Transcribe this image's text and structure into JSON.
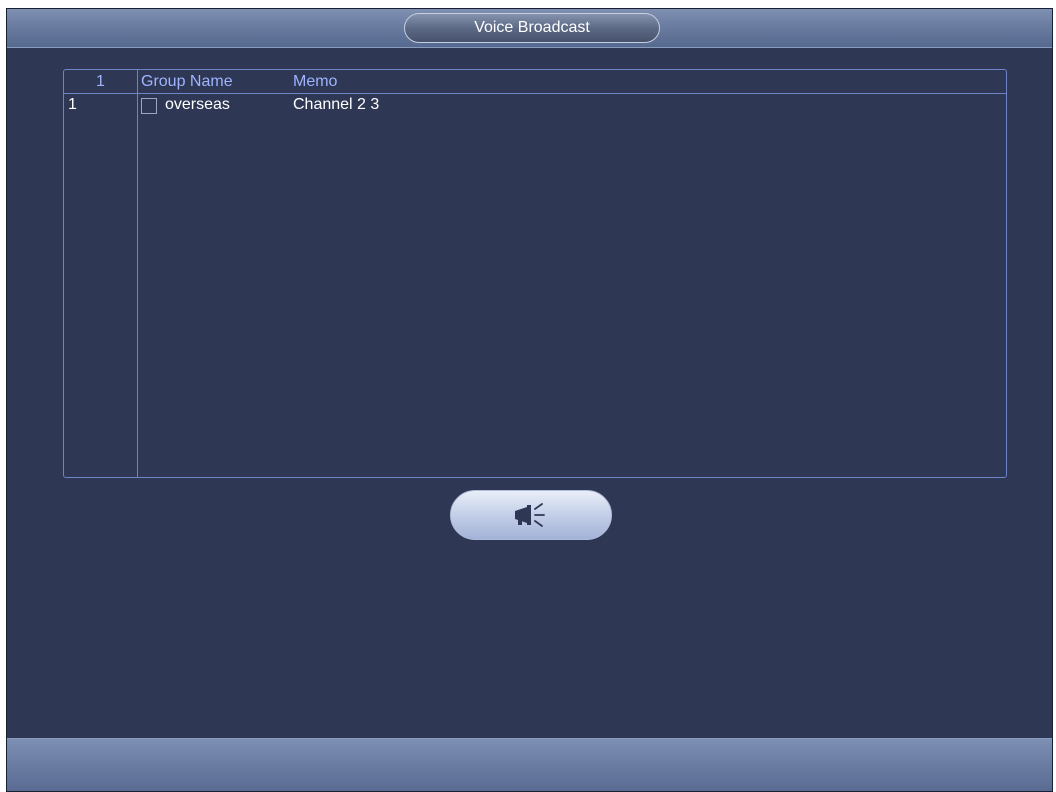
{
  "window": {
    "title": "Voice Broadcast"
  },
  "table": {
    "columns": {
      "index": "1",
      "group_name": "Group Name",
      "memo": "Memo"
    },
    "rows": [
      {
        "index": "1",
        "checked": false,
        "group_name": "overseas",
        "memo": "Channel  2  3"
      }
    ]
  },
  "broadcast_button": {
    "icon": "megaphone-icon"
  },
  "colors": {
    "window_bg": "#2e3754",
    "grid_line": "#6f83c9",
    "header_text": "#9fb3ff",
    "cell_text": "#ffffff"
  }
}
